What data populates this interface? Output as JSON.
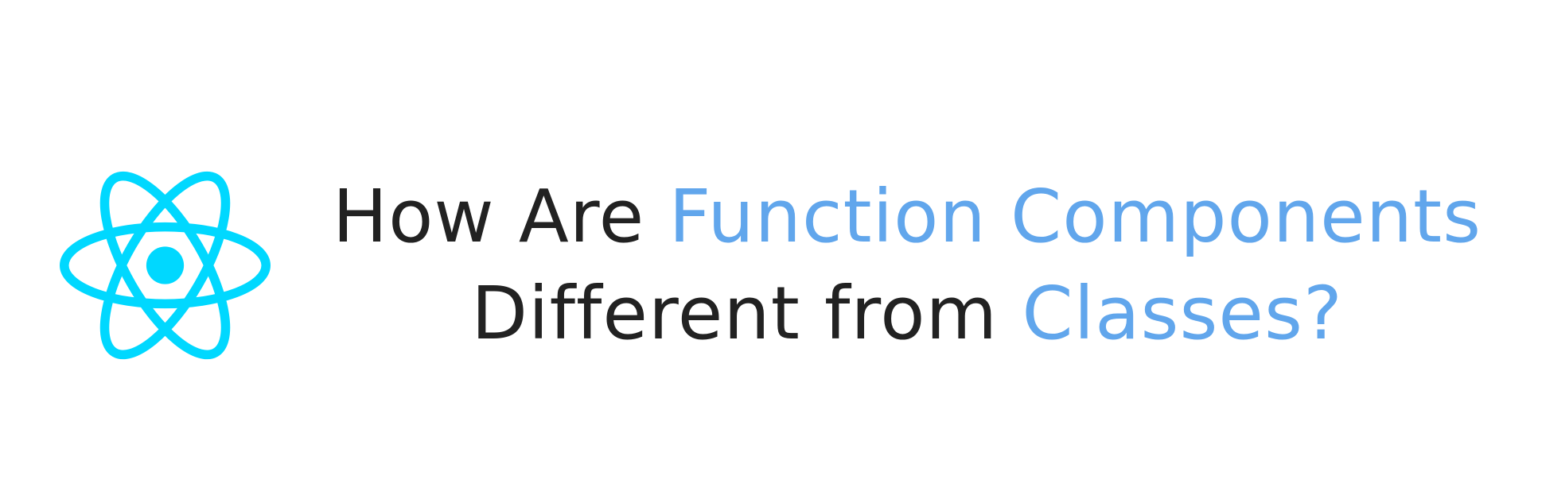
{
  "logo": {
    "name": "react-logo-icon",
    "color": "#00d8ff"
  },
  "title": {
    "line1": {
      "plain": "How Are ",
      "accent": "Function Components"
    },
    "line2": {
      "plain": "Different from ",
      "accent": "Classes?"
    }
  },
  "colors": {
    "text": "#222222",
    "accent": "#61a6ec",
    "background": "#ffffff"
  }
}
